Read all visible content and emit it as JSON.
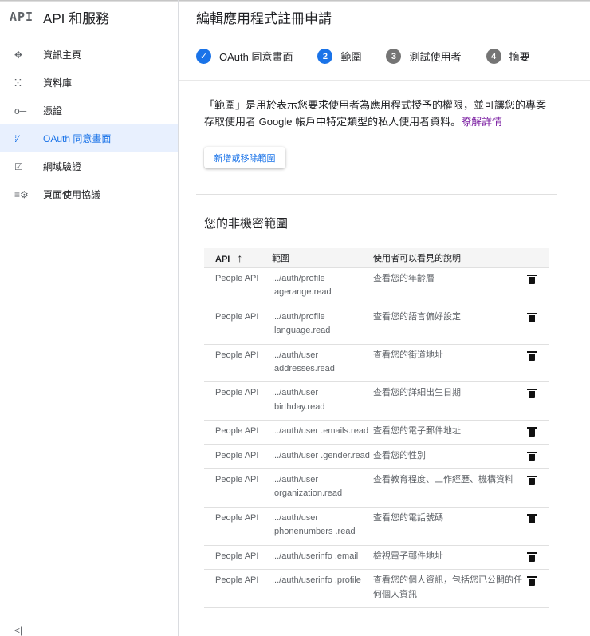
{
  "sidebar": {
    "logo": "API",
    "title": "API 和服務",
    "items": [
      {
        "icon": "✥",
        "label": "資訊主頁"
      },
      {
        "icon": "ⵘ",
        "label": "資料庫"
      },
      {
        "icon": "o─",
        "label": "憑證"
      },
      {
        "icon": "⁞⁄",
        "label": "OAuth 同意畫面"
      },
      {
        "icon": "☑",
        "label": "網域驗證"
      },
      {
        "icon": "≡⚙",
        "label": "頁面使用協議"
      }
    ],
    "collapse": "<|"
  },
  "header": {
    "title": "編輯應用程式註冊申請"
  },
  "stepper": {
    "steps": [
      {
        "num": "✓",
        "label": "OAuth 同意畫面"
      },
      {
        "num": "2",
        "label": "範圍"
      },
      {
        "num": "3",
        "label": "測試使用者"
      },
      {
        "num": "4",
        "label": "摘要"
      }
    ],
    "separator": "—"
  },
  "intro": {
    "text": "「範圍」是用於表示您要求使用者為應用程式授予的權限，並可讓您的專案存取使用者 Google 帳戶中特定類型的私人使用者資料。",
    "link": "瞭解詳情"
  },
  "add_button": "新增或移除範圍",
  "section_title": "您的非機密範圍",
  "table": {
    "headers": {
      "api": "API",
      "sort": "↑",
      "scope": "範圍",
      "desc": "使用者可以看見的說明"
    },
    "rows": [
      {
        "api": "People API",
        "scope": ".../auth/profile .agerange.read",
        "desc": "查看您的年齡層"
      },
      {
        "api": "People API",
        "scope": ".../auth/profile .language.read",
        "desc": "查看您的語言偏好設定"
      },
      {
        "api": "People API",
        "scope": ".../auth/user .addresses.read",
        "desc": "查看您的街道地址"
      },
      {
        "api": "People API",
        "scope": ".../auth/user .birthday.read",
        "desc": "查看您的詳細出生日期"
      },
      {
        "api": "People API",
        "scope": ".../auth/user .emails.read",
        "desc": "查看您的電子郵件地址"
      },
      {
        "api": "People API",
        "scope": ".../auth/user .gender.read",
        "desc": "查看您的性別"
      },
      {
        "api": "People API",
        "scope": ".../auth/user .organization.read",
        "desc": "查看教育程度、工作經歷、機構資料"
      },
      {
        "api": "People API",
        "scope": ".../auth/user .phonenumbers .read",
        "desc": "查看您的電話號碼"
      },
      {
        "api": "People API",
        "scope": ".../auth/userinfo .email",
        "desc": "檢視電子郵件地址"
      },
      {
        "api": "People API",
        "scope": ".../auth/userinfo .profile",
        "desc": "查看您的個人資訊，包括您已公開的任何個人資訊"
      }
    ]
  }
}
